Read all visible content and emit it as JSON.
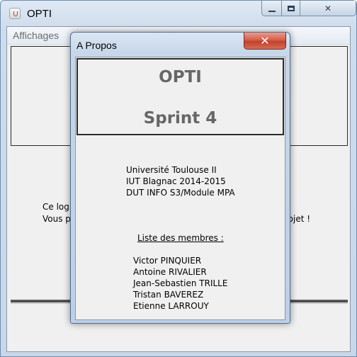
{
  "main_window": {
    "title": "OPTI",
    "icon": "java-cup-icon",
    "caption_buttons": {
      "minimize": "minimize-icon",
      "maximize": "maximize-icon",
      "close": "close-icon"
    },
    "menu": {
      "items": [
        {
          "label": "Affichages"
        }
      ]
    },
    "background_text": {
      "line1": "Ce logi",
      "line2_start": "Vous p",
      "line2_end": "rojet !"
    }
  },
  "dialog": {
    "title": "A Propos",
    "close_glyph": "✕",
    "header": {
      "title": "OPTI",
      "subtitle": "Sprint 4"
    },
    "info_lines": [
      "Université Toulouse II",
      "IUT Blagnac 2014-2015",
      "DUT INFO S3/Module MPA"
    ],
    "members_heading": "Liste des membres :",
    "members": [
      "Victor PINQUIER",
      "Antoine RIVALIER",
      "Jean-Sebastien TRILLE",
      "Tristan BAVEREZ",
      "Etienne LARROUY"
    ]
  },
  "colors": {
    "frame": "#c9d7e8",
    "client": "#f0f0f0",
    "heading_gray": "#666666",
    "close_red": "#c2412b"
  }
}
